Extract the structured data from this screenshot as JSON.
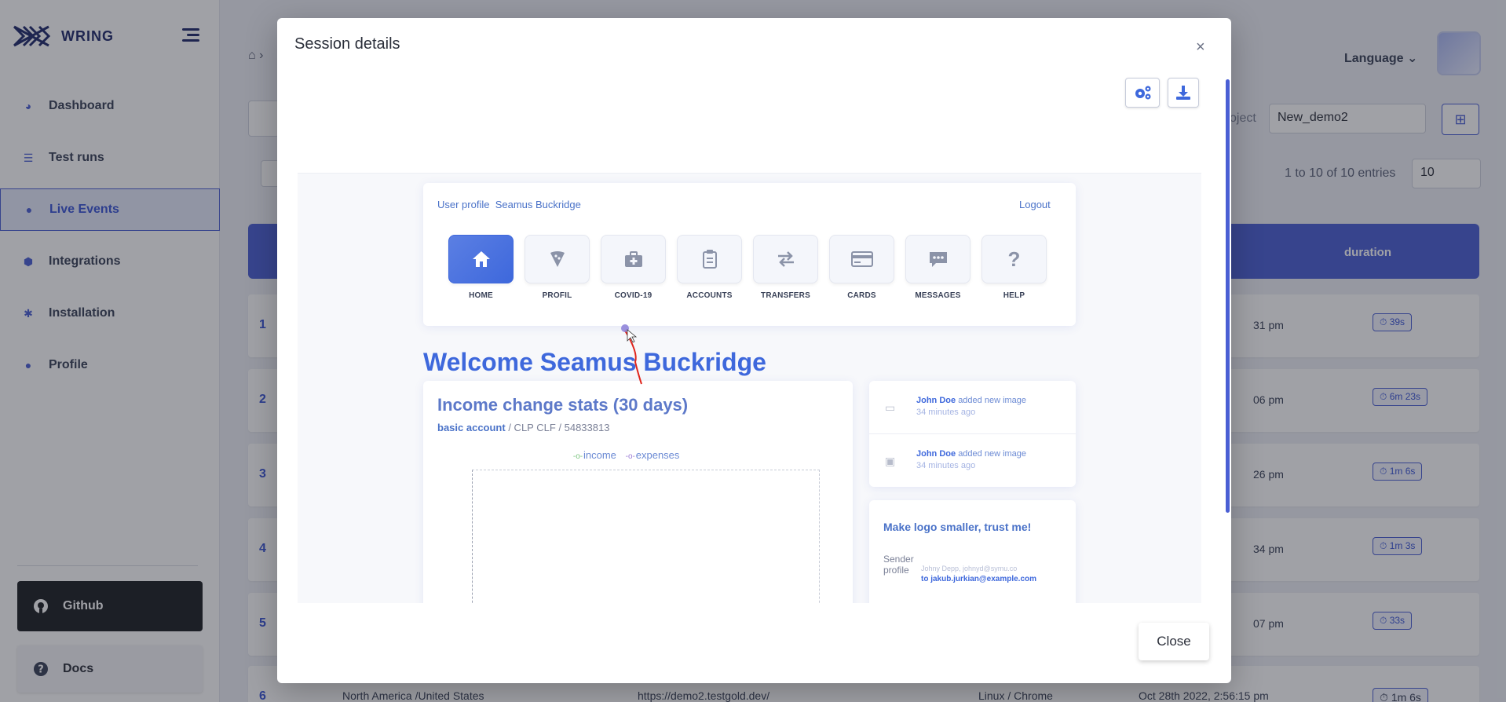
{
  "brand": {
    "name": "WRING"
  },
  "sidebar": {
    "items": [
      {
        "label": "Dashboard",
        "icon": "pie-chart-icon"
      },
      {
        "label": "Test runs",
        "icon": "list-icon"
      },
      {
        "label": "Live Events",
        "icon": "lightbulb-icon",
        "active": true
      },
      {
        "label": "Integrations",
        "icon": "cube-icon"
      },
      {
        "label": "Installation",
        "icon": "gear-icon"
      },
      {
        "label": "Profile",
        "icon": "user-icon"
      }
    ],
    "github_label": "Github",
    "docs_label": "Docs"
  },
  "header": {
    "language_label": "Language",
    "project_label": "oject",
    "project_value": "New_demo2"
  },
  "table": {
    "entries_text": "1 to 10 of 10 entries",
    "page_size": "10",
    "duration_header": "duration",
    "rows": [
      {
        "num": "1",
        "time": "31 pm",
        "duration": "39s"
      },
      {
        "num": "2",
        "time": "06 pm",
        "duration": "6m 23s"
      },
      {
        "num": "3",
        "time": "26 pm",
        "duration": "1m 6s"
      },
      {
        "num": "4",
        "time": "34 pm",
        "duration": "1m 3s"
      },
      {
        "num": "5",
        "time": "07 pm",
        "duration": "33s"
      }
    ],
    "row6": {
      "num": "6",
      "region": "North America /United States",
      "url": "https://demo2.testgold.dev/",
      "platform": "Linux / Chrome",
      "date": "Oct 28th 2022, 2:56:15 pm",
      "duration": "1m 6s"
    }
  },
  "modal": {
    "title": "Session details",
    "close_label": "Close",
    "replay": {
      "user_image_alt": "User profile",
      "user_name": "Seamus Buckridge",
      "logout_label": "Logout",
      "menu": [
        {
          "label": "HOME",
          "icon": "home-icon",
          "active": true
        },
        {
          "label": "PROFIL",
          "icon": "pizza-icon"
        },
        {
          "label": "COVID-19",
          "icon": "medkit-icon"
        },
        {
          "label": "ACCOUNTS",
          "icon": "clipboard-icon"
        },
        {
          "label": "TRANSFERS",
          "icon": "transfer-arrows-icon"
        },
        {
          "label": "CARDS",
          "icon": "credit-card-icon"
        },
        {
          "label": "MESSAGES",
          "icon": "chat-icon"
        },
        {
          "label": "HELP",
          "icon": "question-icon"
        }
      ],
      "welcome": "Welcome Seamus Buckridge",
      "stats": {
        "title": "Income change stats (30 days)",
        "account": "basic account",
        "account_rest": "/ CLP CLF / 54833813",
        "legend_income": "income",
        "legend_expenses": "expenses"
      },
      "activity": [
        {
          "name": "John Doe",
          "action": "added new image",
          "time": "34 minutes ago"
        },
        {
          "name": "John Doe",
          "action": "added new image",
          "time": "34 minutes ago"
        }
      ],
      "message": {
        "title": "Make logo smaller, trust me!",
        "sender_alt": "Sender profile",
        "from": "Johny Depp, johnyd@symu.co",
        "to": "to jakub.jurkian@example.com"
      }
    }
  },
  "colors": {
    "accent": "#4a5fd4",
    "replay_blue": "#3e68dc",
    "cursor_trail": "#e0241b"
  }
}
